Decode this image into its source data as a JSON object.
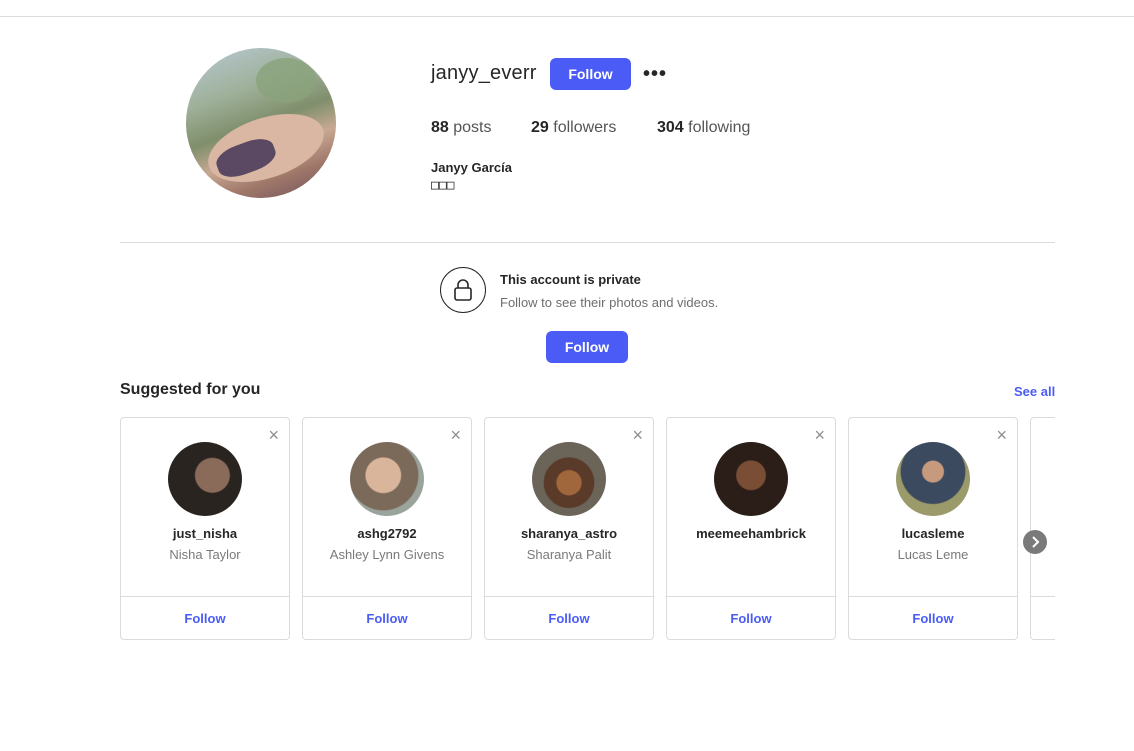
{
  "profile": {
    "username": "janyy_everr",
    "follow_label": "Follow",
    "more_label": "•••",
    "stats": {
      "posts_count": "88",
      "posts_label": "posts",
      "followers_count": "29",
      "followers_label": "followers",
      "following_count": "304",
      "following_label": "following"
    },
    "full_name": "Janyy García",
    "bio": "□□□"
  },
  "private_notice": {
    "title": "This account is private",
    "subtitle": "Follow to see their photos and videos.",
    "follow_label": "Follow"
  },
  "suggested": {
    "title": "Suggested for you",
    "see_all": "See all",
    "close_glyph": "×",
    "follow_label": "Follow",
    "cards": [
      {
        "username": "just_nisha",
        "name": "Nisha Taylor"
      },
      {
        "username": "ashg2792",
        "name": "Ashley Lynn Givens"
      },
      {
        "username": "sharanya_astro",
        "name": "Sharanya Palit"
      },
      {
        "username": "meemeehambrick",
        "name": ""
      },
      {
        "username": "lucasleme",
        "name": "Lucas Leme"
      }
    ]
  },
  "colors": {
    "accent": "#4a5cf5",
    "border": "#dbdbdb",
    "text": "#262626",
    "muted": "#7a7a7a"
  },
  "icons": [
    "more-options-icon",
    "lock-icon",
    "close-icon",
    "chevron-right-icon"
  ]
}
